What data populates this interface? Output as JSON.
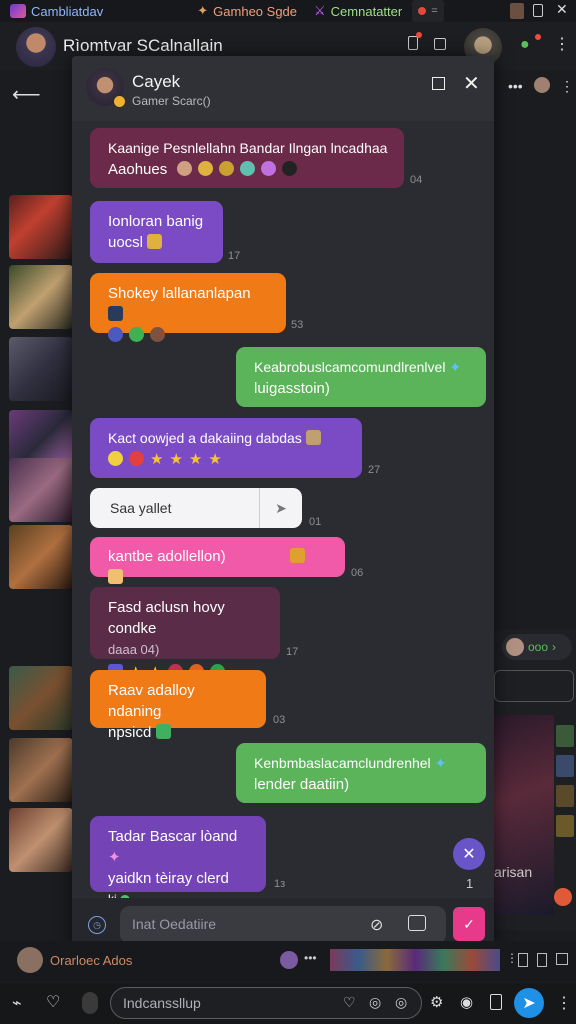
{
  "topbar": {
    "app_name": "Cambliatdav",
    "tab2": "Gamheo Sgde",
    "tab3": "Cemnatatter",
    "tab4": "="
  },
  "header": {
    "title": "Rìomtvar SCalnallain"
  },
  "modal": {
    "name": "Cayek",
    "subtitle": "Gamer Scarc()"
  },
  "messages": [
    {
      "line1": "Kaanige Pesnlellahn Bandar Ilngan lncadhaa",
      "line2": "Aaohues",
      "time": "04"
    },
    {
      "line1": "Ionloran banig",
      "line2": "uocsl",
      "time": "17"
    },
    {
      "line1": "Shokey lallananlapan",
      "time": "53"
    },
    {
      "line1": "Keabrobuslcamcomundlrenlvel",
      "line2": "luigasstoin)"
    },
    {
      "line1": "Kact oowjed a dakaiing dabdas",
      "time": "27"
    },
    {
      "line1": "Saa yallet",
      "time": "01"
    },
    {
      "line1": "kantbe adollellon)",
      "time": "06"
    },
    {
      "line1": "Fasd aclusn hovy condke",
      "line2": "daaa 04)",
      "time": "17"
    },
    {
      "line1": "Raav adalloy ndaning",
      "line2": "npsicd",
      "time": "03"
    },
    {
      "line1": "Kenbmbaslacamclundrenhel",
      "line2": "lender daatiin)"
    },
    {
      "line1": "Tadar Bascar lòand",
      "line2": "yaidkn tèiray clerd",
      "line3": "ki",
      "time": "1з"
    }
  ],
  "composer": {
    "placeholder": "Inat Oedatiire",
    "badge_count": "1"
  },
  "footer_strip": {
    "label": "Orarloec Ados"
  },
  "bottom_bar": {
    "search_placeholder": "Indcanssllup"
  },
  "right_panel": {
    "status": "ooo",
    "label": "arisan"
  },
  "colors": {
    "purple": "#7a4bc4",
    "orange": "#f07a16",
    "green": "#5bb35a",
    "pink": "#f05aa8",
    "accent_blue": "#1e90e6"
  }
}
